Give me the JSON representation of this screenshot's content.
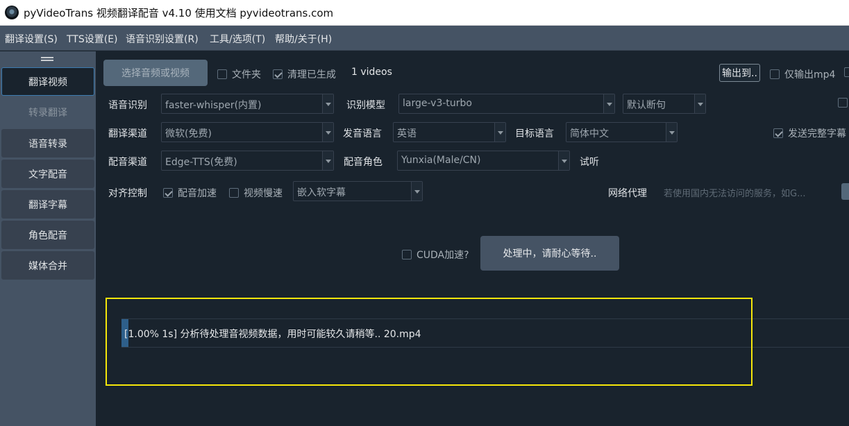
{
  "window": {
    "title": "pyVideoTrans 视频翻译配音 v4.10 使用文档 pyvideotrans.com",
    "icon": "app-logo-icon"
  },
  "menu": [
    "翻译设置(S)",
    "TTS设置(E)",
    "语音识别设置(R)",
    "工具/选项(T)",
    "帮助/关于(H)"
  ],
  "sidebar": {
    "items": [
      {
        "label": "翻译视频",
        "state": "active"
      },
      {
        "label": "转录翻译",
        "state": "disabled"
      },
      {
        "label": "语音转录",
        "state": "normal"
      },
      {
        "label": "文字配音",
        "state": "normal"
      },
      {
        "label": "翻译字幕",
        "state": "normal"
      },
      {
        "label": "角色配音",
        "state": "normal"
      },
      {
        "label": "媒体合并",
        "state": "normal"
      }
    ]
  },
  "toolbar": {
    "select_button": "选择音频或视频",
    "folder_check": "文件夹",
    "folder_checked": false,
    "clean_check": "清理已生成",
    "clean_checked": true,
    "videos_count": "1 videos",
    "output_button": "输出到..",
    "only_mp4_check": "仅输出mp4",
    "only_mp4_checked": false
  },
  "form": {
    "asr_label": "语音识别",
    "asr_value": "faster-whisper(内置)",
    "model_label": "识别模型",
    "model_value": "large-v3-turbo",
    "split_value": "默认断句",
    "trans_label": "翻译渠道",
    "trans_value": "微软(免费)",
    "src_lang_label": "发音语言",
    "src_lang_value": "英语",
    "target_lang_label": "目标语言",
    "target_lang_value": "简体中文",
    "send_full_check": "发送完整字幕",
    "send_full_checked": true,
    "tts_label": "配音渠道",
    "tts_value": "Edge-TTS(免费)",
    "role_label": "配音角色",
    "role_value": "Yunxia(Male/CN)",
    "listen_label": "试听",
    "align_label": "对齐控制",
    "voice_speed_check": "配音加速",
    "voice_speed_checked": true,
    "video_slow_check": "视频慢速",
    "video_slow_checked": false,
    "subtitle_value": "嵌入软字幕",
    "proxy_label": "网络代理",
    "proxy_placeholder": "若使用国内无法访问的服务，如G..."
  },
  "action": {
    "cuda_check": "CUDA加速?",
    "cuda_checked": false,
    "start_button": "处理中，请耐心等待.."
  },
  "log": {
    "progress_percent": 1.0,
    "text": "[1.00%  1s]  分析待处理音视频数据，用时可能较久请稍等.. 20.mp4"
  },
  "colors": {
    "background": "#19232d",
    "panel": "#455364",
    "accent": "#3c7bb0",
    "highlight_box": "#f5e60a"
  }
}
